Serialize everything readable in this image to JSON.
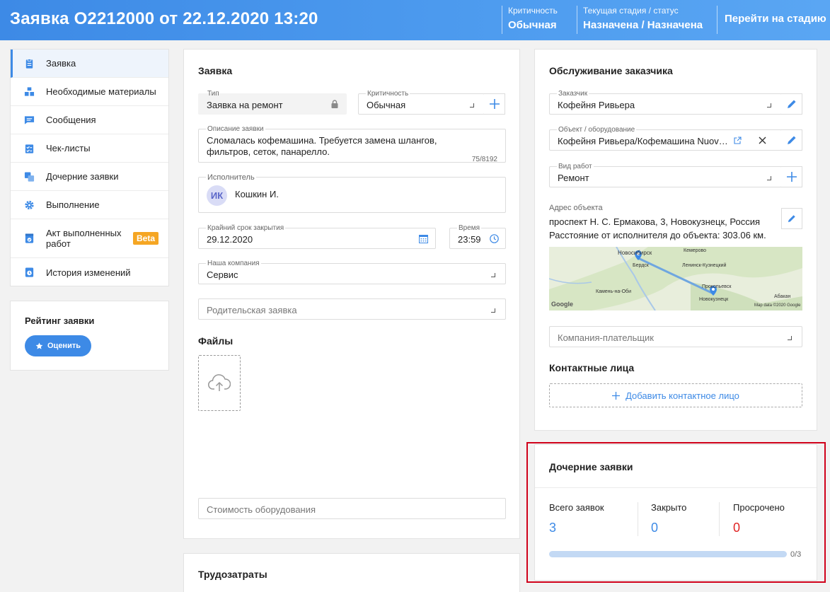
{
  "header": {
    "title": "Заявка O2212000 от 22.12.2020 13:20",
    "criticality_label": "Критичность",
    "criticality_value": "Обычная",
    "stage_label": "Текущая стадия / статус",
    "stage_value": "Назначена / Назначена",
    "go_to_stage": "Перейти на стадию"
  },
  "sidebar": {
    "items": [
      {
        "label": "Заявка",
        "icon": "clipboard-icon"
      },
      {
        "label": "Необходимые материалы",
        "icon": "boxes-icon"
      },
      {
        "label": "Сообщения",
        "icon": "chat-icon"
      },
      {
        "label": "Чек-листы",
        "icon": "checklist-icon"
      },
      {
        "label": "Дочерние заявки",
        "icon": "copy-icon"
      },
      {
        "label": "Выполнение",
        "icon": "gear-icon"
      },
      {
        "label": "Акт выполненных работ",
        "icon": "document-check-icon",
        "badge": "Beta"
      },
      {
        "label": "История изменений",
        "icon": "history-icon"
      }
    ],
    "accent": "#3d8ae6"
  },
  "rating": {
    "title": "Рейтинг заявки",
    "button": "Оценить"
  },
  "request": {
    "title": "Заявка",
    "type_label": "Тип",
    "type_value": "Заявка на ремонт",
    "criticality_label": "Критичность",
    "criticality_value": "Обычная",
    "description_label": "Описание заявки",
    "description_line1": "Сломалась кофемашина. Требуется замена шлангов,",
    "description_line2": "фильтров, сеток, панарелло.",
    "description_counter": "75/8192",
    "executor_label": "Исполнитель",
    "executor_initials": "ИК",
    "executor_name": "Кошкин И.",
    "deadline_label": "Крайний срок закрытия",
    "deadline_value": "29.12.2020",
    "time_label": "Время",
    "time_value": "23:59",
    "company_label": "Наша компания",
    "company_value": "Сервис",
    "parent_placeholder": "Родительская заявка",
    "files_title": "Файлы",
    "equipment_cost_placeholder": "Стоимость оборудования"
  },
  "labor": {
    "title": "Трудозатраты"
  },
  "customer": {
    "title": "Обслуживание заказчика",
    "customer_label": "Заказчик",
    "customer_value": "Кофейня Ривьера",
    "object_label": "Объект / оборудование",
    "object_value": "Кофейня Ривьера/Кофемашина Nuov…",
    "work_type_label": "Вид работ",
    "work_type_value": "Ремонт",
    "address_label": "Адрес объекта",
    "address_value": "проспект Н. С. Ермакова, 3, Новокузнецк, Россия",
    "distance_text": "Расстояние от исполнителя до объекта: 303.06 км.",
    "map": {
      "city_novosibirsk": "Новосибирск",
      "city_berdsk": "Бердск",
      "city_kemerovo": "Кемерово",
      "city_leninsk": "Ленинск-Кузнецкий",
      "city_prokopyevsk": "Прокопьевск",
      "city_novokuznetsk": "Новокузнецк",
      "city_kamen": "Камень-на-Оби",
      "city_abakan": "Абакан",
      "google": "Google",
      "copyright": "Map data ©2020 Google"
    },
    "payer_placeholder": "Компания-плательщик",
    "contacts_title": "Контактные лица",
    "add_contact": "Добавить контактное лицо"
  },
  "child_requests": {
    "title": "Дочерние заявки",
    "total_label": "Всего заявок",
    "total_value": "3",
    "closed_label": "Закрыто",
    "closed_value": "0",
    "overdue_label": "Просрочено",
    "overdue_value": "0",
    "progress": 0,
    "progress_text": "0/3",
    "total_color": "#3d8ae6",
    "overdue_color": "#e02424"
  }
}
